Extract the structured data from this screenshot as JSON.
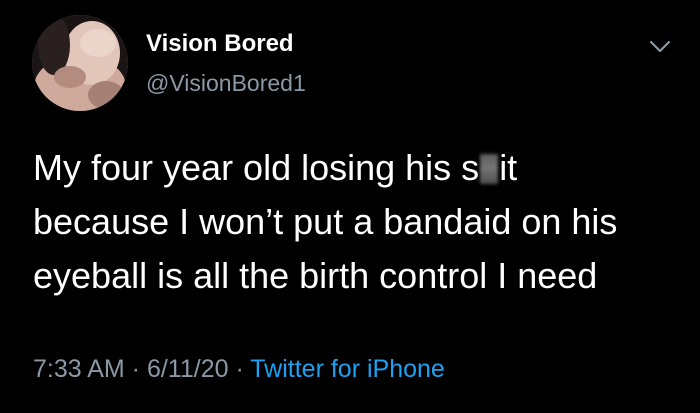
{
  "tweet": {
    "author": {
      "display_name": "Vision Bored",
      "handle": "@VisionBored1",
      "avatar": "profile-photo"
    },
    "menu_icon": "chevron-down-icon",
    "text_lines": [
      {
        "before": "My four year old losing his s",
        "after": "it"
      },
      {
        "text": "because I won’t put a bandaid on his"
      },
      {
        "text": "eyeball is all the birth control I need"
      }
    ],
    "meta": {
      "time": "7:33 AM",
      "separator": " · ",
      "date": "6/11/20",
      "source": "Twitter for iPhone"
    },
    "colors": {
      "background": "#000000",
      "text": "#ffffff",
      "secondary": "#8b98a5",
      "link": "#1da1f2"
    }
  }
}
